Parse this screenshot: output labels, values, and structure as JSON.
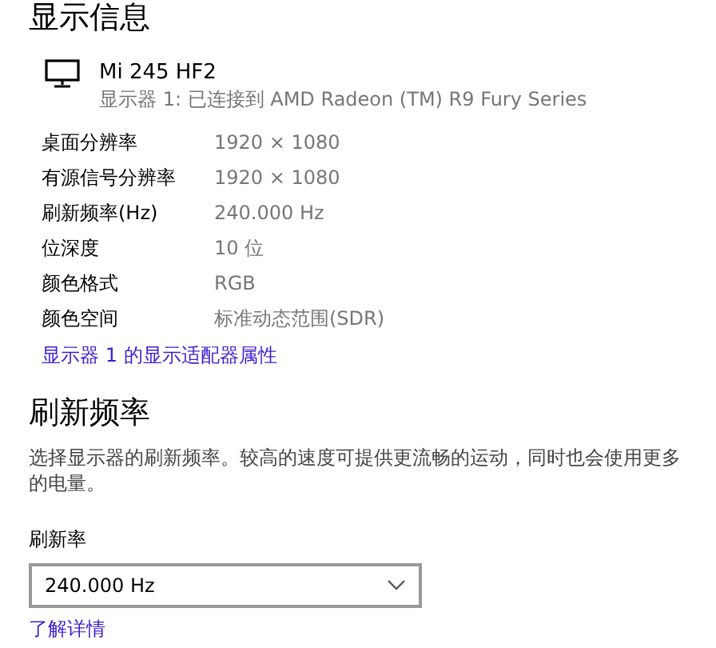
{
  "section_title": "显示信息",
  "monitor": {
    "name": "Mi 245 HF2",
    "description": "显示器 1: 已连接到 AMD Radeon (TM) R9 Fury Series"
  },
  "properties": [
    {
      "label": "桌面分辨率",
      "value": "1920 × 1080"
    },
    {
      "label": "有源信号分辨率",
      "value": "1920 × 1080"
    },
    {
      "label": "刷新频率(Hz)",
      "value": "240.000 Hz"
    },
    {
      "label": "位深度",
      "value": "10 位"
    },
    {
      "label": "颜色格式",
      "value": "RGB"
    },
    {
      "label": "颜色空间",
      "value": "标准动态范围(SDR)"
    }
  ],
  "adapter_link": "显示器 1 的显示适配器属性",
  "refresh_section": {
    "title": "刷新频率",
    "description": "选择显示器的刷新频率。较高的速度可提供更流畅的运动，同时也会使用更多的电量。",
    "field_label": "刷新率",
    "selected_rate": "240.000 Hz",
    "link": "了解详情"
  }
}
